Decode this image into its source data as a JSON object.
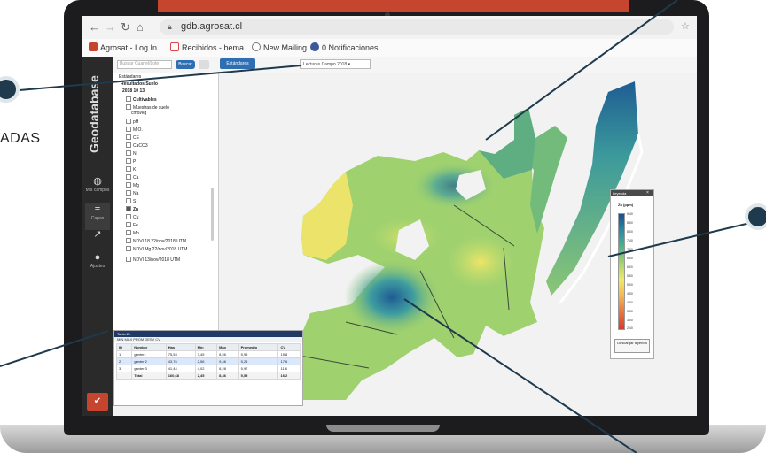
{
  "callouts": {
    "left_text": "ADAS"
  },
  "browser": {
    "url": "gdb.agrosat.cl",
    "bookmarks": [
      "Agrosat - Log In",
      "Recibidos - bema...",
      "New Mailing",
      "0 Notificaciones"
    ]
  },
  "app": {
    "brand": "Geodatabase",
    "toolbar": {
      "search_placeholder": "Buscar Cuartel/Lote",
      "search_button": "Buscar",
      "active_tab": "Estándares",
      "layer_select": "Lecturas Campo 2018"
    },
    "sidebar": [
      {
        "icon": "globe-icon",
        "label": "Mis campos"
      },
      {
        "icon": "layers-icon",
        "label": "Capas"
      },
      {
        "icon": "wrench-icon",
        "label": ""
      },
      {
        "icon": "user-icon",
        "label": "Ajustes"
      }
    ],
    "tree": {
      "title": "Estándares",
      "items": [
        "Resultados Suelo",
        "2018 10 13",
        "Cultivables",
        "Muestras de suelo",
        "cmol/kg",
        "pH",
        "M.O.",
        "CE",
        "CaCO3",
        "N",
        "P",
        "K",
        "Ca",
        "Mg",
        "Na",
        "S",
        "Zn",
        "Cu",
        "Fe",
        "Mn",
        "NDVI 18 22/nov/2018 UTM",
        "NDVI Mg 22/nov/2018 UTM",
        "NDVI 13/nov/2018 UTM"
      ]
    },
    "table": {
      "title": "Tabla Zn",
      "tools": "MIN MAX PROM DESV CV",
      "columns": [
        "ID",
        "Nombre",
        "Has",
        "Mín",
        "Máx",
        "Promedio",
        "CV"
      ],
      "rows": [
        [
          "1",
          "gunter1",
          "75,53",
          "3,45",
          "8,56",
          "5,95",
          "15,8"
        ],
        [
          "2",
          "gunter 2",
          "43,76",
          "2,56",
          "9,46",
          "5,25",
          "17,6"
        ],
        [
          "3",
          "gunter 3",
          "41,44",
          "4,02",
          "8,28",
          "5,97",
          "11,6"
        ],
        [
          "",
          "Total",
          "160,68",
          "2,45",
          "8,46",
          "5,55",
          "16,2"
        ]
      ]
    },
    "legend": {
      "title": "Leyenda",
      "label": "Zn (ppm)",
      "ticks": [
        "9,40",
        "8,50",
        "8,00",
        "7,40",
        "7,00",
        "6,50",
        "6,00",
        "5,50",
        "5,00",
        "4,50",
        "4,00",
        "3,50",
        "3,00",
        "2,40"
      ],
      "button": "Descargar leyenda"
    }
  }
}
